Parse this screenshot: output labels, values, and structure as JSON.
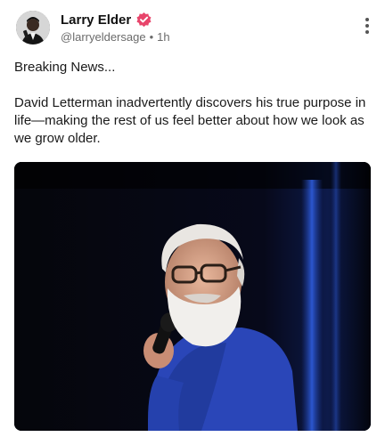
{
  "post": {
    "author": {
      "name": "Larry Elder",
      "handle": "@larryeldersage",
      "separator": "•",
      "time": "1h",
      "verified_color": "#e8456b",
      "avatar_icon": "profile-photo"
    },
    "menu_icon": "more-vertical-icon",
    "text_lines": [
      "Breaking News...",
      "David Letterman inadvertently discovers his true purpose in life—making the rest of us feel better about how we look as we grow older."
    ],
    "media": {
      "type": "photo",
      "subject": "photo"
    }
  }
}
